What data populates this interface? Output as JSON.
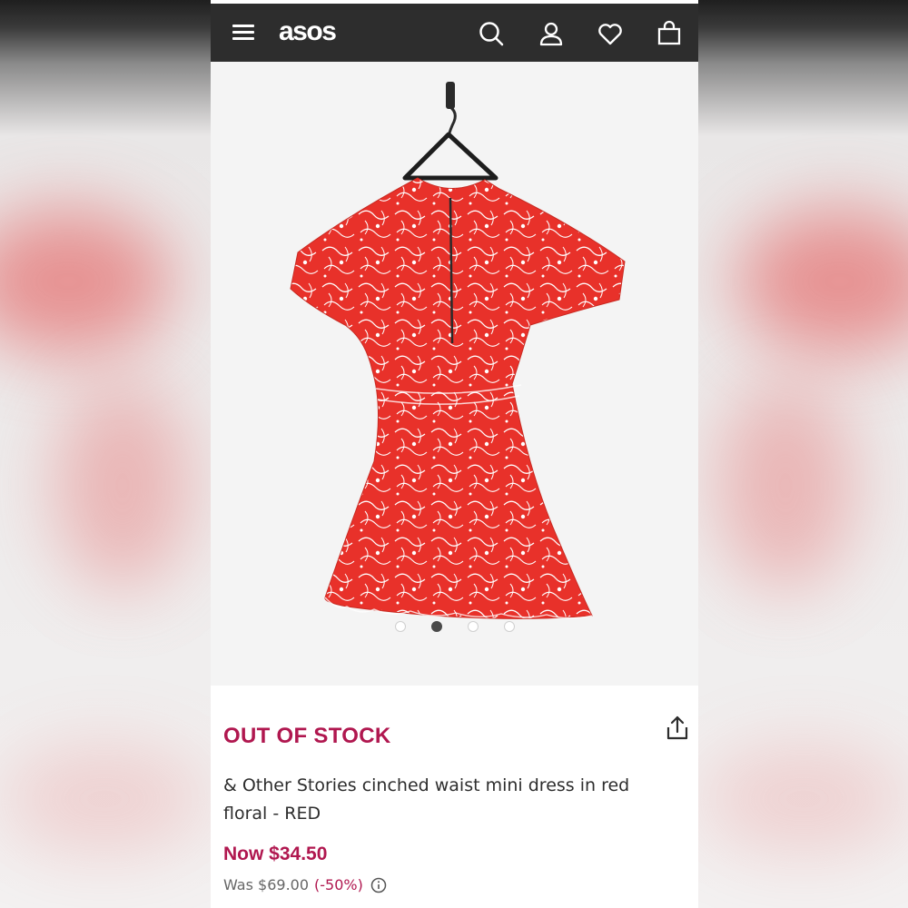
{
  "header": {
    "logo": "asos",
    "icons": [
      "menu-icon",
      "search-icon",
      "account-icon",
      "heart-icon",
      "bag-icon"
    ]
  },
  "gallery": {
    "image_count": 4,
    "active_index": 1
  },
  "product": {
    "stock_status": "OUT OF STOCK",
    "title": "& Other Stories cinched waist mini dress in red floral - RED",
    "price_now": "Now $34.50",
    "price_was": "Was $69.00",
    "discount": "(-50%)"
  },
  "colors": {
    "topbar": "#2d2d2d",
    "accent": "#b0174f",
    "dress": "#e8312a"
  }
}
